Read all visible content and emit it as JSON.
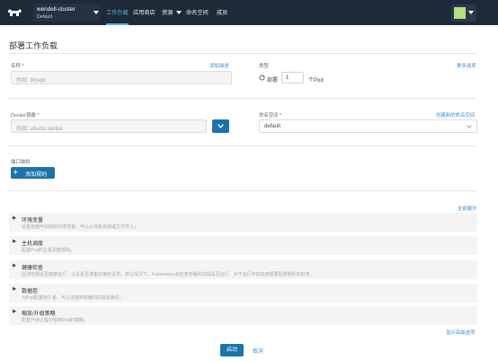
{
  "header": {
    "cluster_name": "wendell-cluster",
    "namespace": "Default",
    "nav": [
      "工作负载",
      "应用商店",
      "资源",
      "命名空间",
      "成员"
    ]
  },
  "page": {
    "title": "部署工作负载"
  },
  "form": {
    "name_label": "名称 *",
    "add_description": "添加描述",
    "name_placeholder": "例如: Myapp",
    "type_label": "类型",
    "more_options": "更多选项",
    "deploy_label": "部署",
    "pod_count": "1",
    "pod_unit": "个Pod",
    "image_label": "Docker镜像 *",
    "image_placeholder": "例如: ubuntu:xenial",
    "ns_label": "命名空间 *",
    "create_ns": "创建新的命名空间",
    "ns_value": "default",
    "port_label": "端口映射",
    "add_rule": "添加规则"
  },
  "sections": {
    "expand_all": "全部展开",
    "items": [
      {
        "title": "环境变量",
        "desc": "设置容器可识别的环境变量，可以从现有资源或文件导入。"
      },
      {
        "title": "主机调度",
        "desc": "配置Pod的主机调度规则。"
      },
      {
        "title": "健康检查",
        "desc": "监测容器是否健康运行，以及是否准备好接收请求。默认情况下，Kubernetes会检查容器的进程是否运行，对于运行中的应用需要配置额外的检查。"
      },
      {
        "title": "数据卷",
        "desc": "为Pod配置持久卷，可以挂载到容器内的指定路径。"
      },
      {
        "title": "缩放/升级策略",
        "desc": "配置升级过程中替换Pod的策略。"
      }
    ],
    "show_advanced": "显示高级选项"
  },
  "actions": {
    "launch": "启动",
    "cancel": "取消"
  },
  "colors": {
    "header_bg": "#1e2a38",
    "accent": "#1a73ad",
    "link": "#3a8fd5"
  }
}
